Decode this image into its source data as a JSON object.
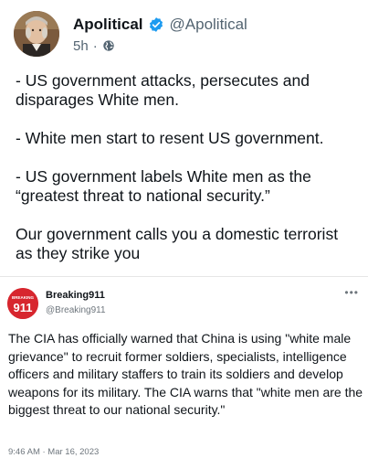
{
  "post": {
    "display_name": "Apolitical",
    "handle": "@Apolitical",
    "time": "5h",
    "separator": "·",
    "visibility_icon": "globe-icon",
    "verified_icon": "verified-badge-icon",
    "accent_color": "#1d9bf0",
    "lines": [
      "- US government attacks, persecutes and disparages White men.",
      "- White men start to resent US government.",
      "- US government labels White men as the “greatest threat to national security.”",
      "Our government calls you a domestic terrorist as they strike you"
    ]
  },
  "quoted": {
    "display_name": "Breaking911",
    "handle": "@Breaking911",
    "avatar_text": "BREAKING 911",
    "avatar_color": "#d7262e",
    "more_icon": "more-horizontal-icon",
    "more_label": "•••",
    "text": "The CIA has officially warned that China is using \"white male grievance\" to recruit former soldiers, specialists, intelligence officers and military staffers to train its soldiers and develop weapons for its military. The CIA warns that \"white men are the biggest threat to our national security.\"",
    "timestamp": "9:46 AM · Mar 16, 2023"
  }
}
